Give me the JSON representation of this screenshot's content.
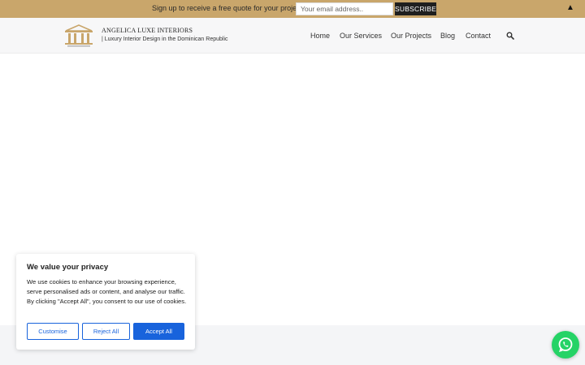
{
  "topbar": {
    "text": "Sign up to receive a free quote for your project",
    "email_placeholder": "Your email address..",
    "subscribe_label": "SUBSCRIBE",
    "close_glyph": "▲",
    "background": "#c9a66b"
  },
  "header": {
    "brand_name": "ANGELICA LUXE INTERIORS",
    "tagline": "| Luxury Interior Design in the Dominican Republic",
    "logo_icon": "columns-logo-icon",
    "nav": {
      "home": "Home",
      "services": "Our Services",
      "projects": "Our Projects",
      "blog": "Blog",
      "contact": "Contact"
    },
    "search_icon": "search-icon"
  },
  "cookie_banner": {
    "title": "We value your privacy",
    "body": "We use cookies to enhance your browsing experience, serve personalised ads or content, and analyse our traffic. By clicking \"Accept All\", you consent to our use of cookies.",
    "customise_label": "Customise",
    "reject_label": "Reject All",
    "accept_label": "Accept All",
    "accent_color": "#1863dc"
  },
  "whatsapp": {
    "icon": "whatsapp-icon",
    "color": "#25d366"
  }
}
